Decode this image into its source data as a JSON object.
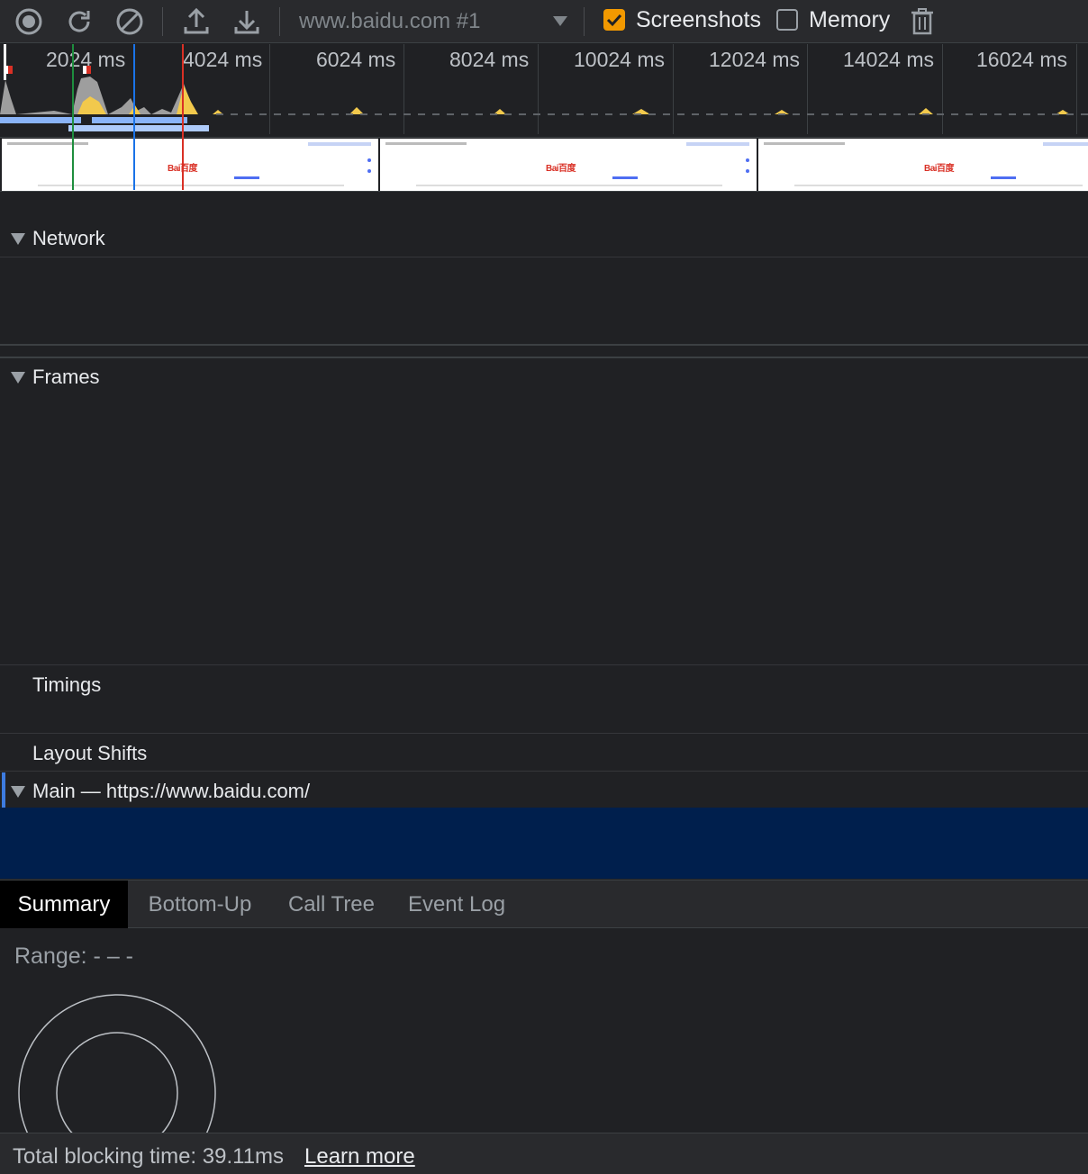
{
  "toolbar": {
    "target": "www.baidu.com #1",
    "screenshots_label": "Screenshots",
    "screenshots_checked": true,
    "memory_label": "Memory",
    "memory_checked": false,
    "icons": [
      "record-icon",
      "reload-icon",
      "clear-icon",
      "upload-icon",
      "download-icon",
      "trash-icon"
    ]
  },
  "overview": {
    "ruler": [
      "2024 ms",
      "4024 ms",
      "6024 ms",
      "8024 ms",
      "10024 ms",
      "12024 ms",
      "14024 ms",
      "16024 ms"
    ],
    "screenshot_logo": "Bai百度"
  },
  "tracks": {
    "network": "Network",
    "frames": "Frames",
    "timings": "Timings",
    "layout_shifts": "Layout Shifts",
    "main": "Main — https://www.baidu.com/"
  },
  "tabs": [
    "Summary",
    "Bottom-Up",
    "Call Tree",
    "Event Log"
  ],
  "active_tab": "Summary",
  "summary": {
    "range": "Range: - – -"
  },
  "footer": {
    "total_blocking": "Total blocking time: 39.11ms",
    "learn_more": "Learn more"
  },
  "colors": {
    "scripting": "#f2c94c",
    "loading": "#8ab4f8",
    "dcl_marker": "#1e8e3e",
    "load_marker": "#1a73e8",
    "fcp_marker": "#d93025",
    "checkbox_accent": "#f29900"
  }
}
